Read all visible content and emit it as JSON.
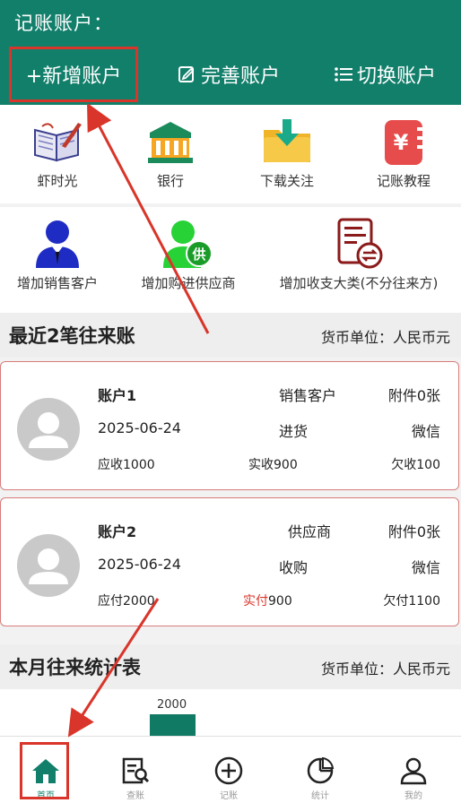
{
  "header": {
    "title": "记账账户：",
    "actions": {
      "add": "+新增账户",
      "improve": "完善账户",
      "switch": "切换账户"
    }
  },
  "shortcuts_row1": [
    {
      "label": "虾时光",
      "icon": "notebook-icon"
    },
    {
      "label": "银行",
      "icon": "bank-icon"
    },
    {
      "label": "下载关注",
      "icon": "download-folder-icon"
    },
    {
      "label": "记账教程",
      "icon": "yen-ledger-icon"
    }
  ],
  "shortcuts_row2": [
    {
      "label": "增加销售客户",
      "icon": "customer-icon"
    },
    {
      "label": "增加购进供应商",
      "icon": "supplier-icon"
    },
    {
      "label": "增加收支大类(不分往来方)",
      "icon": "document-transfer-icon"
    }
  ],
  "recent": {
    "title": "最近2笔往来账",
    "unit": "货币单位：人民币元"
  },
  "records": [
    {
      "name": "账户1",
      "type": "销售客户",
      "attachments": "附件0张",
      "date": "2025-06-24",
      "category": "进货",
      "channel": "微信",
      "due_label": "应收",
      "due_value": "1000",
      "paid_label": "实收",
      "paid_value": "900",
      "owed_label": "欠收",
      "owed_value": "100"
    },
    {
      "name": "账户2",
      "type": "供应商",
      "attachments": "附件0张",
      "date": "2025-06-24",
      "category": "收购",
      "channel": "微信",
      "due_label": "应付",
      "due_value": "2000",
      "paid_label": "实付",
      "paid_value": "900",
      "owed_label": "欠付",
      "owed_value": "1100"
    }
  ],
  "monthly": {
    "title": "本月往来统计表",
    "unit": "货币单位：人民币元"
  },
  "chart_data": {
    "type": "bar",
    "values": [
      2000
    ]
  },
  "tabs": [
    {
      "label": "首页",
      "icon": "home-icon"
    },
    {
      "label": "查账",
      "icon": "ledger-search-icon"
    },
    {
      "label": "记账",
      "icon": "add-circle-icon"
    },
    {
      "label": "统计",
      "icon": "pie-chart-icon"
    },
    {
      "label": "我的",
      "icon": "user-icon"
    }
  ],
  "colors": {
    "brand": "#127f6b",
    "highlight": "#d9352a"
  }
}
